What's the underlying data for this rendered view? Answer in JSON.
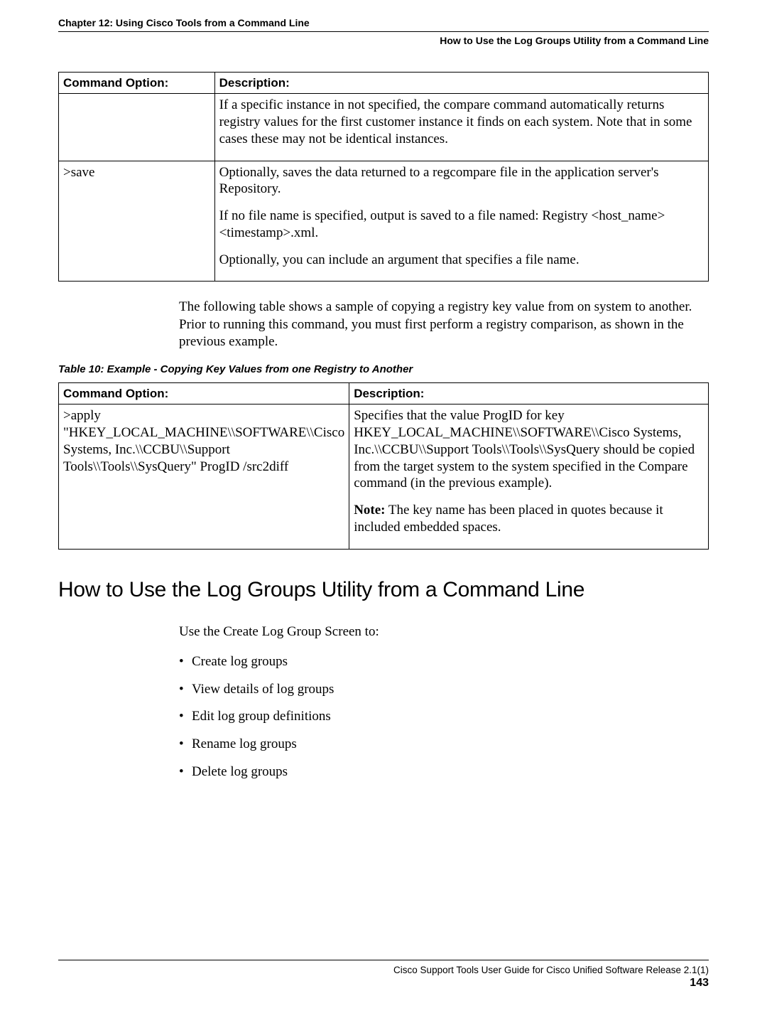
{
  "header": {
    "chapter": "Chapter 12: Using Cisco Tools from a Command Line",
    "section": "How to Use the Log Groups Utility from a Command Line"
  },
  "table1": {
    "headers": {
      "c1": "Command Option:",
      "c2": "Description:"
    },
    "row1": {
      "opt": "",
      "desc": "If a specific instance in not specified, the compare command automatically returns registry values for the first customer instance it finds on each system. Note that in some cases these may not be identical instances."
    },
    "row2": {
      "opt": ">save",
      "desc_p1": "Optionally, saves the data returned to a regcompare file in the application server's Repository.",
      "desc_p2": "If no file name is specified, output is saved to a file named: Registry <host_name> <timestamp>.xml.",
      "desc_p3": "Optionally, you can include an argument that specifies a file name."
    }
  },
  "midPara": "The following table shows a sample of copying a registry key value from on system to another. Prior to running this command, you must first perform a registry comparison, as shown in the previous example.",
  "table2caption": "Table 10: Example - Copying Key Values from one Registry to Another",
  "table2": {
    "headers": {
      "c1": "Command Option:",
      "c2": "Description:"
    },
    "row1": {
      "opt": ">apply \"HKEY_LOCAL_MACHINE\\\\SOFTWARE\\\\Cisco Systems, Inc.\\\\CCBU\\\\Support Tools\\\\Tools\\\\SysQuery\" ProgID /src2diff",
      "desc_p1": "Specifies that the value ProgID for key HKEY_LOCAL_MACHINE\\\\SOFTWARE\\\\Cisco Systems, Inc.\\\\CCBU\\\\Support Tools\\\\Tools\\\\SysQuery should be copied from the target system to the system specified in the Compare command (in the previous example).",
      "note_label": "Note:",
      "note_text": " The key name has been placed in quotes because it included embedded spaces."
    }
  },
  "h2": "How to Use the Log Groups Utility from a Command Line",
  "lead": "Use the Create Log Group Screen to:",
  "bullets": [
    "Create log groups",
    "View details of log groups",
    "Edit log group definitions",
    "Rename log groups",
    "Delete log groups"
  ],
  "footer": {
    "guide": "Cisco Support Tools User Guide for Cisco Unified Software Release 2.1(1)",
    "page": "143"
  }
}
